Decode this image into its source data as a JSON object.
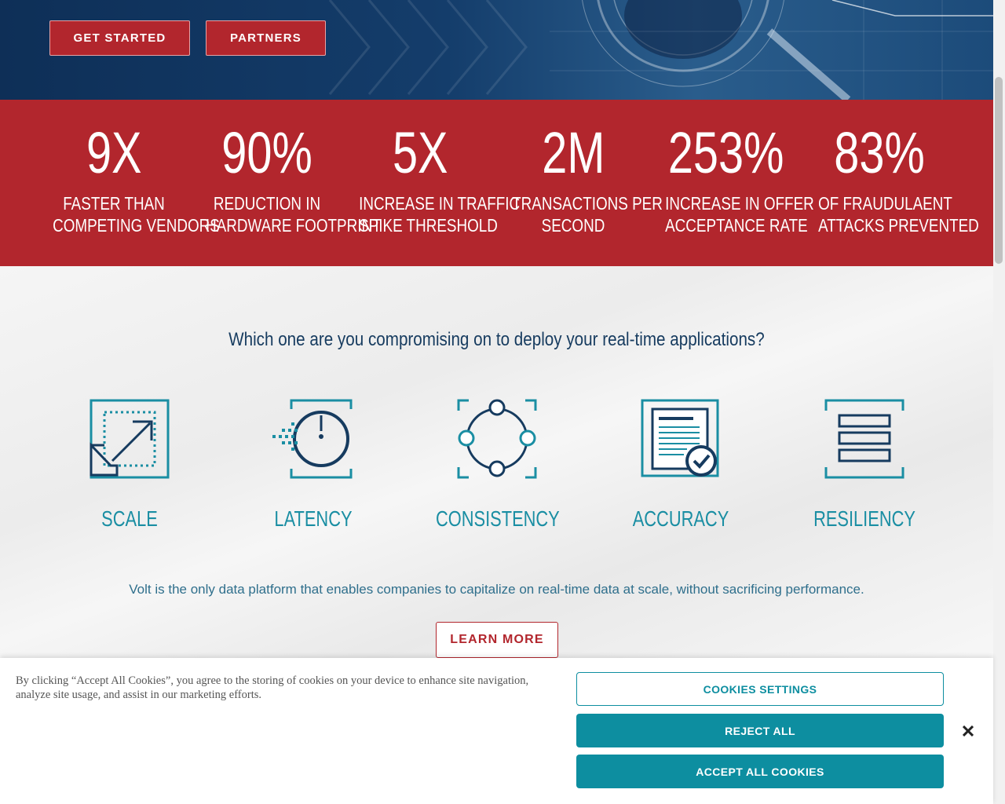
{
  "hero": {
    "get_started_label": "GET STARTED",
    "partners_label": "PARTNERS"
  },
  "stats": [
    {
      "value": "9X",
      "label_line1": "FASTER THAN",
      "label_line2": "COMPETING VENDORS"
    },
    {
      "value": "90%",
      "label_line1": "REDUCTION IN",
      "label_line2": "HARDWARE FOOTPRINT"
    },
    {
      "value": "5X",
      "label_line1": "INCREASE IN TRAFFIC",
      "label_line2": "SPIKE THRESHOLD"
    },
    {
      "value": "2M",
      "label_line1": "TRANSACTIONS PER",
      "label_line2": "SECOND"
    },
    {
      "value": "253%",
      "label_line1": "INCREASE IN OFFER",
      "label_line2": "ACCEPTANCE RATE"
    },
    {
      "value": "83%",
      "label_line1": "OF FRAUDULAENT",
      "label_line2": "ATTACKS PREVENTED"
    }
  ],
  "main": {
    "question": "Which one are you compromising on to deploy your real-time applications?",
    "features": [
      {
        "label": "SCALE",
        "icon": "scale-icon"
      },
      {
        "label": "LATENCY",
        "icon": "latency-icon"
      },
      {
        "label": "CONSISTENCY",
        "icon": "consistency-icon"
      },
      {
        "label": "ACCURACY",
        "icon": "accuracy-icon"
      },
      {
        "label": "RESILIENCY",
        "icon": "resiliency-icon"
      }
    ],
    "tagline": "Volt is the only data platform that enables companies to capitalize on real-time data at scale, without sacrificing performance.",
    "learn_more_label": "LEARN MORE"
  },
  "cookie": {
    "text": "By clicking “Accept All Cookies”, you agree to the storing of cookies on your device to enhance site navigation, analyze site usage, and assist in our marketing efforts.",
    "settings_label": "COOKIES SETTINGS",
    "reject_label": "REJECT ALL",
    "accept_label": "ACCEPT ALL COOKIES"
  },
  "colors": {
    "brand_red": "#b2262d",
    "hero_navy": "#143d6b",
    "teal": "#0d8ea0",
    "icon_navy": "#163b5f"
  }
}
